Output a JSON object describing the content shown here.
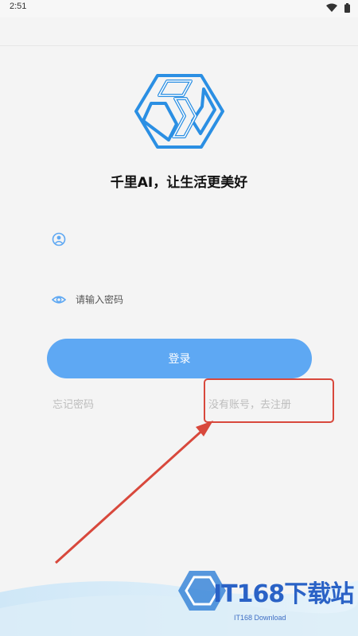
{
  "status_bar": {
    "time": "2:51"
  },
  "app": {
    "tagline": "千里AI，让生活更美好",
    "username_field": {
      "value": "",
      "placeholder": ""
    },
    "password_field": {
      "value": "",
      "placeholder": "请输入密码"
    },
    "login_label": "登录",
    "forgot_password_label": "忘记密码",
    "register_label": "没有账号，去注册"
  },
  "watermark": {
    "title": "IT168下载站",
    "subtitle": "IT168 Download"
  },
  "colors": {
    "primary": "#5ea8f3",
    "logo_blue": "#2b8fe3",
    "annotation_red": "#d8483c",
    "muted_text": "#bdbdbd",
    "watermark_blue": "#2a62c6"
  },
  "icons": {
    "wifi": "wifi-icon",
    "battery": "battery-icon",
    "user": "user-icon",
    "eye": "eye-icon"
  }
}
